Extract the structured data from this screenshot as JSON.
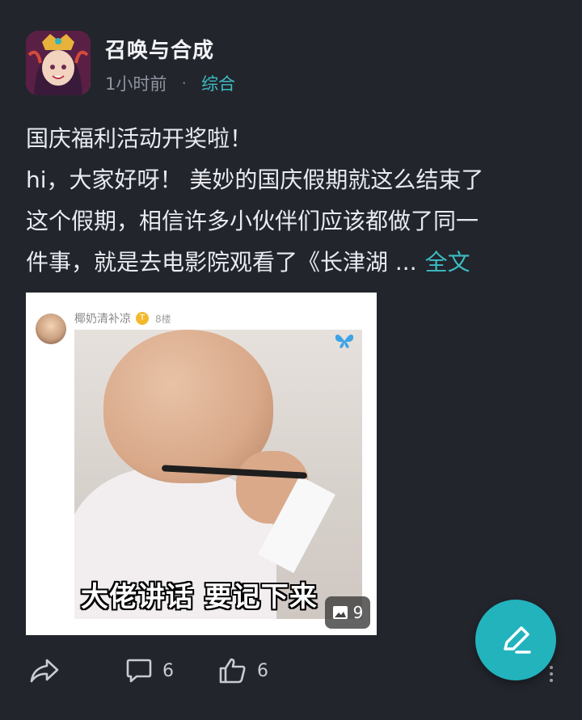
{
  "post": {
    "author": "召唤与合成",
    "time": "1小时前",
    "separator": "·",
    "category": "综合",
    "title_line": "国庆福利活动开奖啦！",
    "body_lines": [
      "hi，大家好呀！ 美妙的国庆假期就这么结束了",
      "这个假期，相信许多小伙伴们应该都做了同一",
      "件事，就是去电影院观看了《长津湖 ..."
    ],
    "full_text_link": "全文"
  },
  "image_card": {
    "username": "椰奶清补凉",
    "level": "T",
    "floor": "8楼",
    "caption": "大佬讲话 要记下来",
    "image_count": "9"
  },
  "actions": {
    "comments": "6",
    "likes": "6"
  },
  "colors": {
    "background": "#22252c",
    "accent": "#3dbdc4",
    "fab": "#22b3bd"
  },
  "icons": [
    "share-icon",
    "comment-icon",
    "like-icon",
    "image-icon",
    "edit-pen-icon",
    "butterfly-icon"
  ]
}
